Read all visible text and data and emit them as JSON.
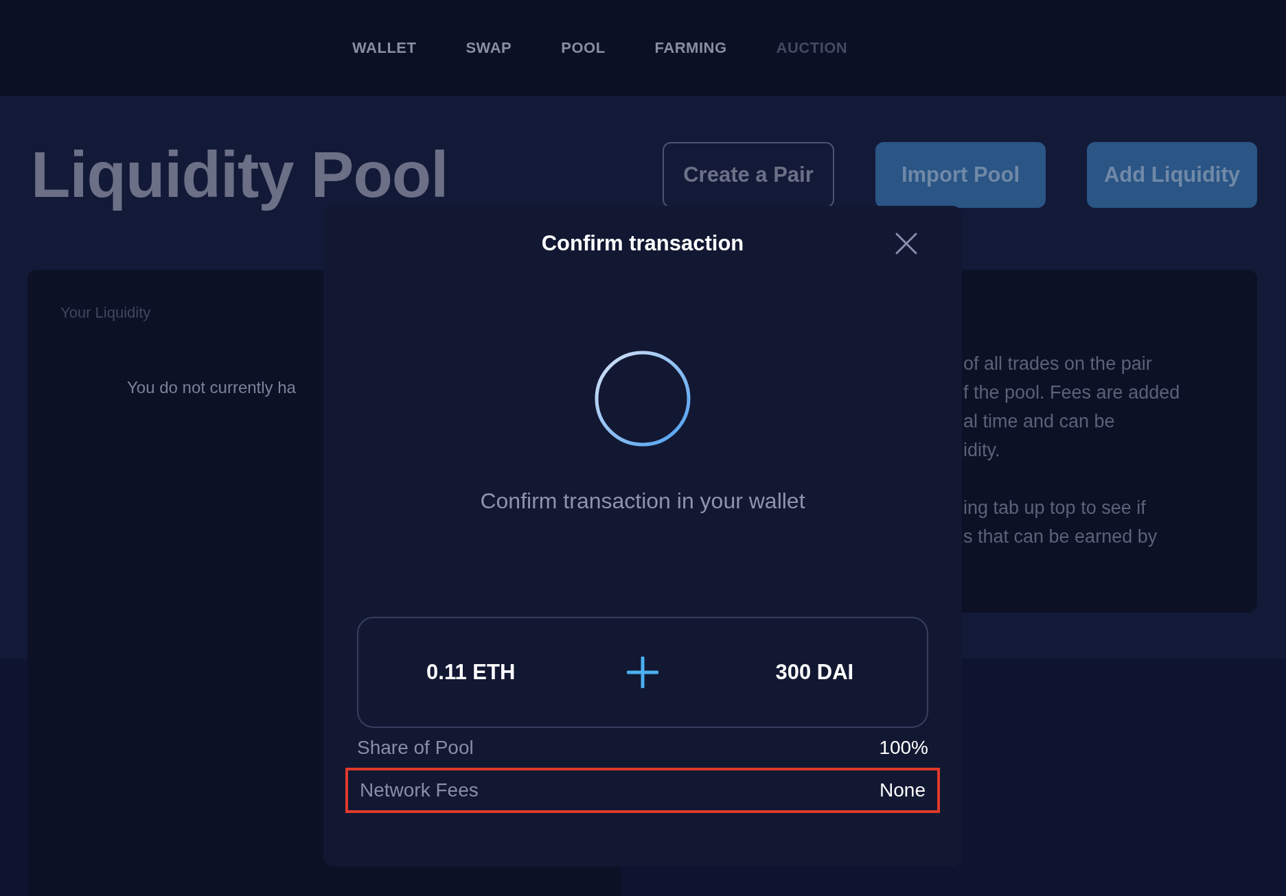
{
  "nav": {
    "items": [
      {
        "label": "WALLET",
        "disabled": false
      },
      {
        "label": "SWAP",
        "disabled": false
      },
      {
        "label": "POOL",
        "disabled": false
      },
      {
        "label": "FARMING",
        "disabled": false
      },
      {
        "label": "AUCTION",
        "disabled": true
      }
    ]
  },
  "page": {
    "title": "Liquidity Pool",
    "buttons": [
      {
        "label": "Create a Pair",
        "kind": "outline"
      },
      {
        "label": "Import Pool",
        "kind": "filled"
      },
      {
        "label": "Add Liquidity",
        "kind": "filled"
      }
    ]
  },
  "your_liquidity": {
    "heading": "Your Liquidity",
    "message": "You do not currently ha"
  },
  "info_card": {
    "paragraphs": [
      [
        "of all trades on the pair",
        "f the pool. Fees are added",
        "al time and can be",
        "idity."
      ],
      [
        "ing tab up top to see if",
        "s that can be earned by"
      ]
    ]
  },
  "modal": {
    "title": "Confirm transaction",
    "status": "Confirm transaction in your wallet",
    "amounts": [
      "0.11 ETH",
      "300 DAI"
    ],
    "rows": [
      {
        "label": "Share of Pool",
        "value": "100%",
        "highlighted": false
      },
      {
        "label": "Network Fees",
        "value": "None",
        "highlighted": true
      }
    ]
  }
}
